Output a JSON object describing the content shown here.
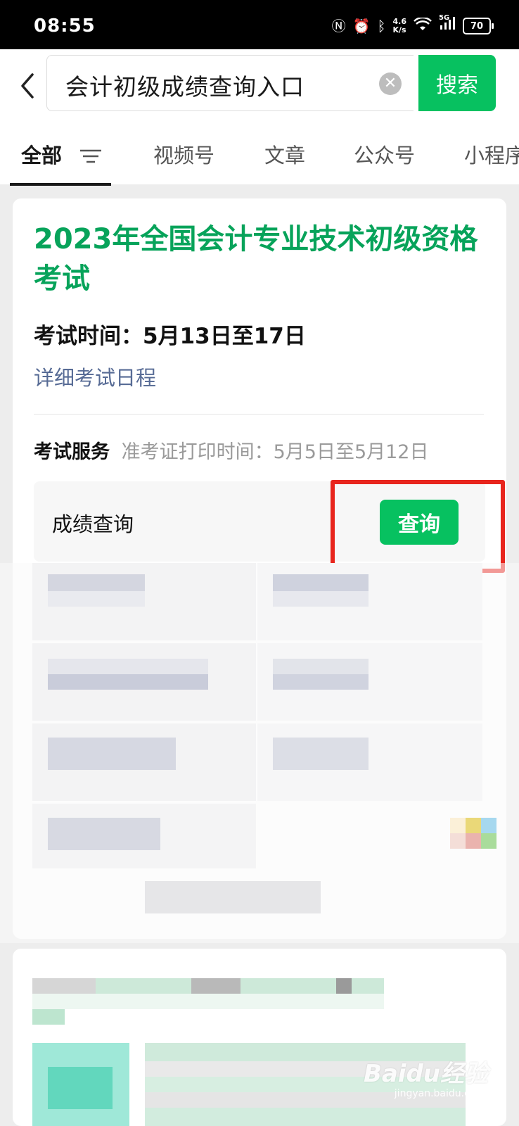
{
  "status_bar": {
    "time": "08:55",
    "speed_value": "4.6",
    "speed_unit": "K/s",
    "network": "5G",
    "battery": "70"
  },
  "search": {
    "query": "会计初级成绩查询入口",
    "button_label": "搜索"
  },
  "tabs": [
    "全部",
    "视频号",
    "文章",
    "公众号",
    "小程序"
  ],
  "card": {
    "title": "2023年全国会计专业技术初级资格考试",
    "exam_time": "考试时间：5月13日至17日",
    "detail_link": "详细考试日程",
    "service_label": "考试服务",
    "service_note": "准考证打印时间：5月5日至5月12日",
    "query_label": "成绩查询",
    "query_button": "查询"
  },
  "watermark": {
    "text": "Baidu经验",
    "sub": "jingyan.baidu.com"
  }
}
